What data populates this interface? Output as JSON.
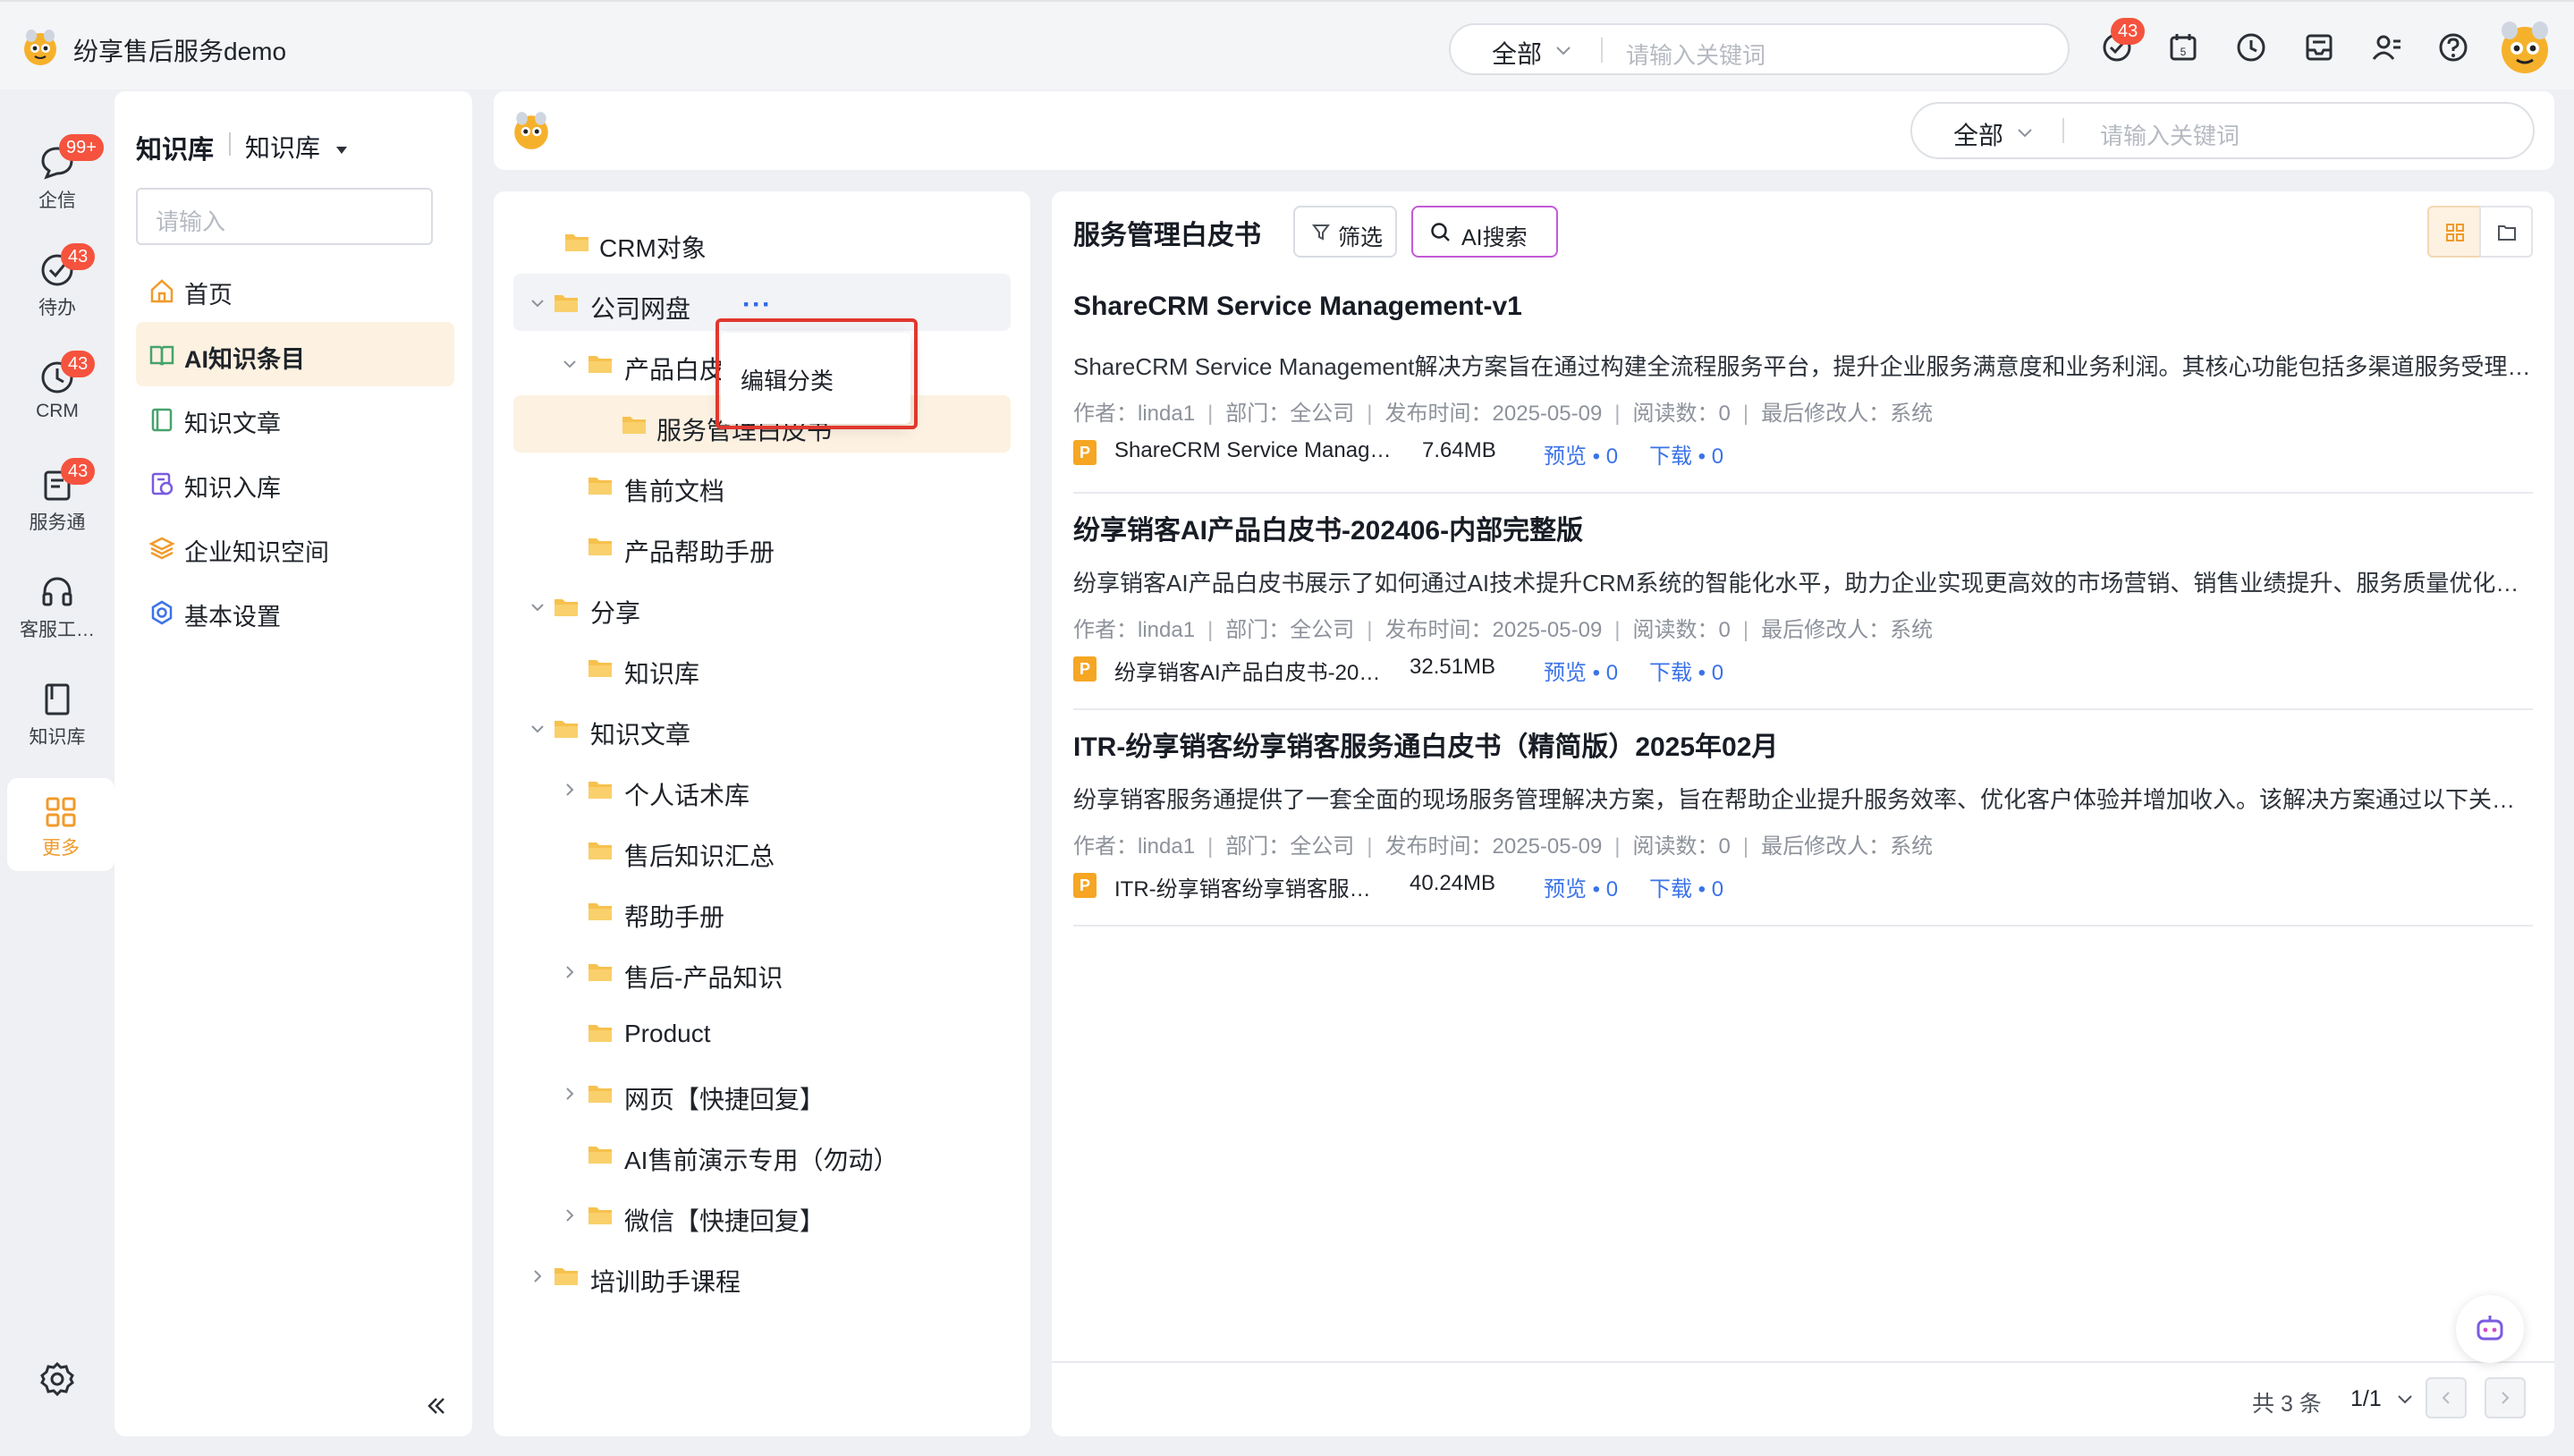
{
  "app": {
    "title": "纷享售后服务demo"
  },
  "top_search": {
    "scope": "全部",
    "placeholder": "请输入关键词"
  },
  "top_icons": {
    "notification_badge": "43"
  },
  "rail": [
    {
      "label": "企信",
      "badge": "99+"
    },
    {
      "label": "待办",
      "badge": "43"
    },
    {
      "label": "CRM",
      "badge": "43"
    },
    {
      "label": "服务通",
      "badge": "43"
    },
    {
      "label": "客服工…",
      "badge": ""
    },
    {
      "label": "知识库",
      "badge": ""
    },
    {
      "label": "更多",
      "badge": ""
    }
  ],
  "sidebar": {
    "title": "知识库",
    "subtitle": "知识库",
    "search_placeholder": "请输入",
    "items": [
      {
        "label": "首页"
      },
      {
        "label": "AI知识条目"
      },
      {
        "label": "知识文章"
      },
      {
        "label": "知识入库"
      },
      {
        "label": "企业知识空间"
      },
      {
        "label": "基本设置"
      }
    ]
  },
  "content_search": {
    "scope": "全部",
    "placeholder": "请输入关键词"
  },
  "tree": {
    "nodes": [
      {
        "label": "CRM对象"
      },
      {
        "label": "公司网盘"
      },
      {
        "label": "产品白皮"
      },
      {
        "label": "服务管理白皮书"
      },
      {
        "label": "售前文档"
      },
      {
        "label": "产品帮助手册"
      },
      {
        "label": "分享"
      },
      {
        "label": "知识库"
      },
      {
        "label": "知识文章"
      },
      {
        "label": "个人话术库"
      },
      {
        "label": "售后知识汇总"
      },
      {
        "label": "帮助手册"
      },
      {
        "label": "售后-产品知识"
      },
      {
        "label": "Product"
      },
      {
        "label": "网页【快捷回复】"
      },
      {
        "label": "AI售前演示专用（勿动）"
      },
      {
        "label": "微信【快捷回复】"
      },
      {
        "label": "培训助手课程"
      }
    ],
    "more": "···",
    "context_menu": {
      "edit_category": "编辑分类"
    }
  },
  "docs": {
    "title": "服务管理白皮书",
    "filter_label": "筛选",
    "ai_search_label": "AI搜索",
    "articles": [
      {
        "title": "ShareCRM Service Management-v1",
        "summary": "ShareCRM Service Management解决方案旨在通过构建全流程服务平台，提升企业服务满意度和业务利润。其核心功能包括多渠道服务受理…",
        "author": "作者：linda1",
        "dept": "部门：全公司",
        "published": "发布时间：2025-05-09",
        "reads": "阅读数：0",
        "modifier": "最后修改人：系统",
        "file_name": "ShareCRM Service Manag…",
        "file_size": "7.64MB",
        "preview": "预览 • 0",
        "download": "下载 • 0"
      },
      {
        "title": "纷享销客AI产品白皮书-202406-内部完整版",
        "summary": "纷享销客AI产品白皮书展示了如何通过AI技术提升CRM系统的智能化水平，助力企业实现更高效的市场营销、销售业绩提升、服务质量优化…",
        "author": "作者：linda1",
        "dept": "部门：全公司",
        "published": "发布时间：2025-05-09",
        "reads": "阅读数：0",
        "modifier": "最后修改人：系统",
        "file_name": "纷享销客AI产品白皮书-202…",
        "file_size": "32.51MB",
        "preview": "预览 • 0",
        "download": "下载 • 0"
      },
      {
        "title": "ITR-纷享销客纷享销客服务通白皮书（精简版）2025年02月",
        "summary": "纷享销客服务通提供了一套全面的现场服务管理解决方案，旨在帮助企业提升服务效率、优化客户体验并增加收入。该解决方案通过以下关…",
        "author": "作者：linda1",
        "dept": "部门：全公司",
        "published": "发布时间：2025-05-09",
        "reads": "阅读数：0",
        "modifier": "最后修改人：系统",
        "file_name": "ITR-纷享销客纷享销客服务…",
        "file_size": "40.24MB",
        "preview": "预览 • 0",
        "download": "下载 • 0"
      }
    ],
    "file_type_letter": "P",
    "total": "共 3 条",
    "page": "1/1"
  },
  "colors": {
    "accent": "#f6a623",
    "link": "#3b73e8",
    "badge": "#f5533e",
    "highlight": "#e0382f"
  }
}
